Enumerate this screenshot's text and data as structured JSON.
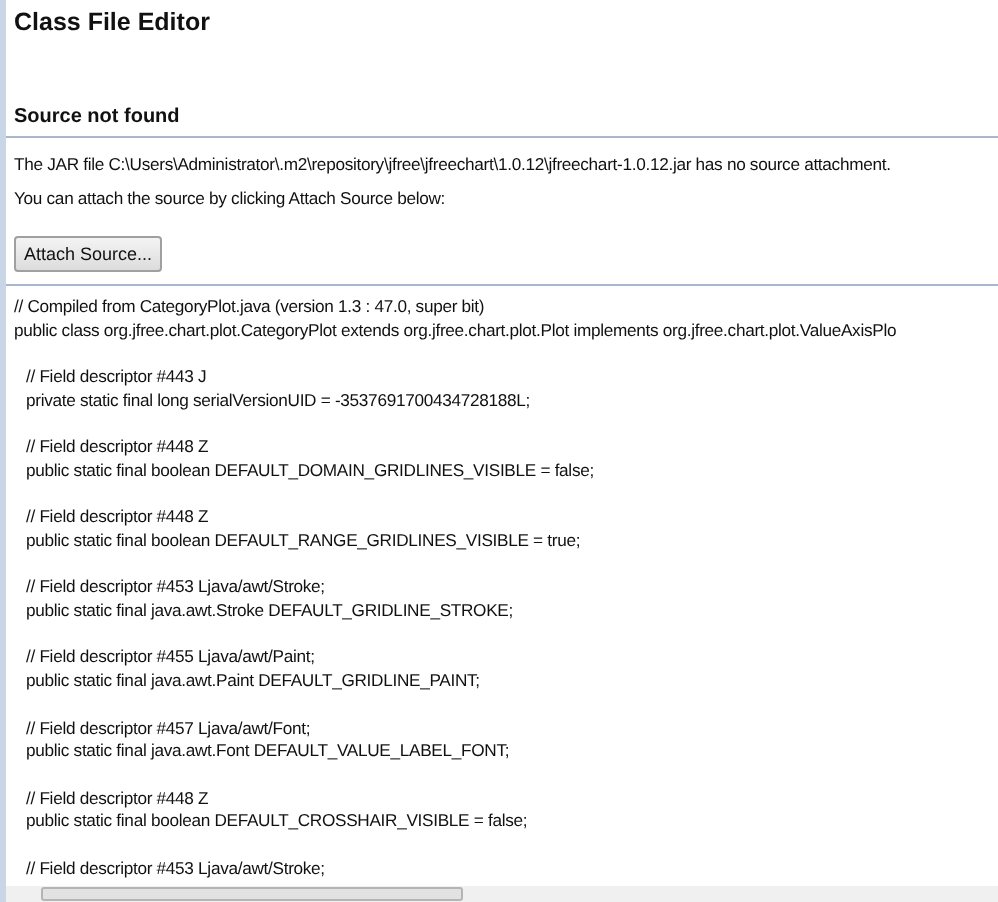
{
  "editor": {
    "title": "Class File Editor",
    "notice": {
      "heading": "Source not found",
      "message_lines": [
        "The JAR file C:\\Users\\Administrator\\.m2\\repository\\jfree\\jfreechart\\1.0.12\\jfreechart-1.0.12.jar has no source attachment.",
        "You can attach the source by clicking Attach Source below:"
      ],
      "button": "Attach Source..."
    },
    "code": {
      "header": [
        "// Compiled from CategoryPlot.java (version 1.3 : 47.0, super bit)",
        "public class org.jfree.chart.plot.CategoryPlot extends org.jfree.chart.plot.Plot implements org.jfree.chart.plot.ValueAxisPlo"
      ],
      "fields": [
        {
          "comment": "// Field descriptor #443 J",
          "declaration": "private static final long serialVersionUID = -3537691700434728188L;"
        },
        {
          "comment": "// Field descriptor #448 Z",
          "declaration": "public static final boolean DEFAULT_DOMAIN_GRIDLINES_VISIBLE = false;"
        },
        {
          "comment": "// Field descriptor #448 Z",
          "declaration": "public static final boolean DEFAULT_RANGE_GRIDLINES_VISIBLE = true;"
        },
        {
          "comment": "// Field descriptor #453 Ljava/awt/Stroke;",
          "declaration": "public static final java.awt.Stroke DEFAULT_GRIDLINE_STROKE;"
        },
        {
          "comment": "// Field descriptor #455 Ljava/awt/Paint;",
          "declaration": "public static final java.awt.Paint DEFAULT_GRIDLINE_PAINT;"
        },
        {
          "comment": "// Field descriptor #457 Ljava/awt/Font;",
          "declaration": "public static final java.awt.Font DEFAULT_VALUE_LABEL_FONT;"
        },
        {
          "comment": "// Field descriptor #448 Z",
          "declaration": "public static final boolean DEFAULT_CROSSHAIR_VISIBLE = false;"
        },
        {
          "comment": "// Field descriptor #453 Ljava/awt/Stroke;"
        }
      ]
    }
  }
}
